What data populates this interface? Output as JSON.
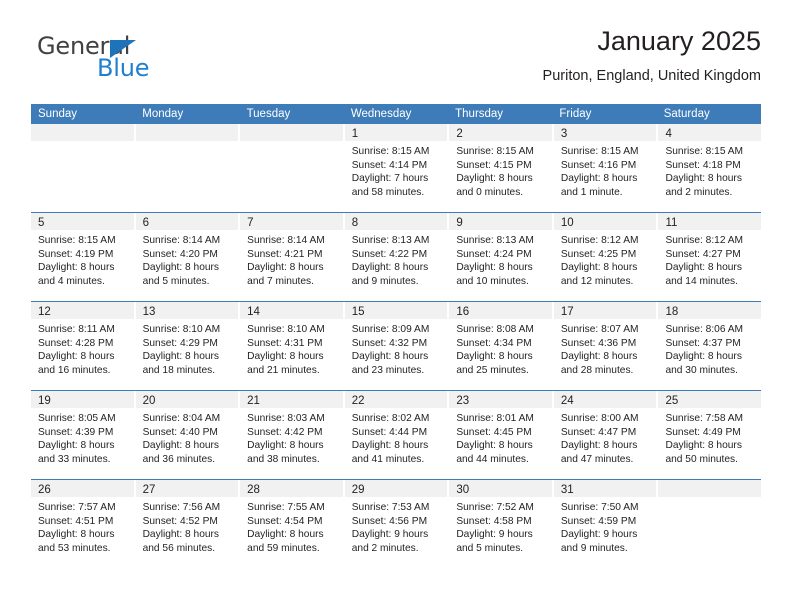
{
  "logo": {
    "word1": "General",
    "word2": "Blue",
    "triangle_color": "#1f73b8",
    "blue_color": "#1f7fd0"
  },
  "header": {
    "title": "January 2025",
    "subtitle": "Puriton, England, United Kingdom"
  },
  "calendar": {
    "header_bg": "#3d7cb8",
    "day_band_bg": "#f1f1f1",
    "weekdays": [
      "Sunday",
      "Monday",
      "Tuesday",
      "Wednesday",
      "Thursday",
      "Friday",
      "Saturday"
    ],
    "weeks": [
      [
        {
          "day": "",
          "lines": []
        },
        {
          "day": "",
          "lines": []
        },
        {
          "day": "",
          "lines": []
        },
        {
          "day": "1",
          "lines": [
            "Sunrise: 8:15 AM",
            "Sunset: 4:14 PM",
            "Daylight: 7 hours",
            "and 58 minutes."
          ]
        },
        {
          "day": "2",
          "lines": [
            "Sunrise: 8:15 AM",
            "Sunset: 4:15 PM",
            "Daylight: 8 hours",
            "and 0 minutes."
          ]
        },
        {
          "day": "3",
          "lines": [
            "Sunrise: 8:15 AM",
            "Sunset: 4:16 PM",
            "Daylight: 8 hours",
            "and 1 minute."
          ]
        },
        {
          "day": "4",
          "lines": [
            "Sunrise: 8:15 AM",
            "Sunset: 4:18 PM",
            "Daylight: 8 hours",
            "and 2 minutes."
          ]
        }
      ],
      [
        {
          "day": "5",
          "lines": [
            "Sunrise: 8:15 AM",
            "Sunset: 4:19 PM",
            "Daylight: 8 hours",
            "and 4 minutes."
          ]
        },
        {
          "day": "6",
          "lines": [
            "Sunrise: 8:14 AM",
            "Sunset: 4:20 PM",
            "Daylight: 8 hours",
            "and 5 minutes."
          ]
        },
        {
          "day": "7",
          "lines": [
            "Sunrise: 8:14 AM",
            "Sunset: 4:21 PM",
            "Daylight: 8 hours",
            "and 7 minutes."
          ]
        },
        {
          "day": "8",
          "lines": [
            "Sunrise: 8:13 AM",
            "Sunset: 4:22 PM",
            "Daylight: 8 hours",
            "and 9 minutes."
          ]
        },
        {
          "day": "9",
          "lines": [
            "Sunrise: 8:13 AM",
            "Sunset: 4:24 PM",
            "Daylight: 8 hours",
            "and 10 minutes."
          ]
        },
        {
          "day": "10",
          "lines": [
            "Sunrise: 8:12 AM",
            "Sunset: 4:25 PM",
            "Daylight: 8 hours",
            "and 12 minutes."
          ]
        },
        {
          "day": "11",
          "lines": [
            "Sunrise: 8:12 AM",
            "Sunset: 4:27 PM",
            "Daylight: 8 hours",
            "and 14 minutes."
          ]
        }
      ],
      [
        {
          "day": "12",
          "lines": [
            "Sunrise: 8:11 AM",
            "Sunset: 4:28 PM",
            "Daylight: 8 hours",
            "and 16 minutes."
          ]
        },
        {
          "day": "13",
          "lines": [
            "Sunrise: 8:10 AM",
            "Sunset: 4:29 PM",
            "Daylight: 8 hours",
            "and 18 minutes."
          ]
        },
        {
          "day": "14",
          "lines": [
            "Sunrise: 8:10 AM",
            "Sunset: 4:31 PM",
            "Daylight: 8 hours",
            "and 21 minutes."
          ]
        },
        {
          "day": "15",
          "lines": [
            "Sunrise: 8:09 AM",
            "Sunset: 4:32 PM",
            "Daylight: 8 hours",
            "and 23 minutes."
          ]
        },
        {
          "day": "16",
          "lines": [
            "Sunrise: 8:08 AM",
            "Sunset: 4:34 PM",
            "Daylight: 8 hours",
            "and 25 minutes."
          ]
        },
        {
          "day": "17",
          "lines": [
            "Sunrise: 8:07 AM",
            "Sunset: 4:36 PM",
            "Daylight: 8 hours",
            "and 28 minutes."
          ]
        },
        {
          "day": "18",
          "lines": [
            "Sunrise: 8:06 AM",
            "Sunset: 4:37 PM",
            "Daylight: 8 hours",
            "and 30 minutes."
          ]
        }
      ],
      [
        {
          "day": "19",
          "lines": [
            "Sunrise: 8:05 AM",
            "Sunset: 4:39 PM",
            "Daylight: 8 hours",
            "and 33 minutes."
          ]
        },
        {
          "day": "20",
          "lines": [
            "Sunrise: 8:04 AM",
            "Sunset: 4:40 PM",
            "Daylight: 8 hours",
            "and 36 minutes."
          ]
        },
        {
          "day": "21",
          "lines": [
            "Sunrise: 8:03 AM",
            "Sunset: 4:42 PM",
            "Daylight: 8 hours",
            "and 38 minutes."
          ]
        },
        {
          "day": "22",
          "lines": [
            "Sunrise: 8:02 AM",
            "Sunset: 4:44 PM",
            "Daylight: 8 hours",
            "and 41 minutes."
          ]
        },
        {
          "day": "23",
          "lines": [
            "Sunrise: 8:01 AM",
            "Sunset: 4:45 PM",
            "Daylight: 8 hours",
            "and 44 minutes."
          ]
        },
        {
          "day": "24",
          "lines": [
            "Sunrise: 8:00 AM",
            "Sunset: 4:47 PM",
            "Daylight: 8 hours",
            "and 47 minutes."
          ]
        },
        {
          "day": "25",
          "lines": [
            "Sunrise: 7:58 AM",
            "Sunset: 4:49 PM",
            "Daylight: 8 hours",
            "and 50 minutes."
          ]
        }
      ],
      [
        {
          "day": "26",
          "lines": [
            "Sunrise: 7:57 AM",
            "Sunset: 4:51 PM",
            "Daylight: 8 hours",
            "and 53 minutes."
          ]
        },
        {
          "day": "27",
          "lines": [
            "Sunrise: 7:56 AM",
            "Sunset: 4:52 PM",
            "Daylight: 8 hours",
            "and 56 minutes."
          ]
        },
        {
          "day": "28",
          "lines": [
            "Sunrise: 7:55 AM",
            "Sunset: 4:54 PM",
            "Daylight: 8 hours",
            "and 59 minutes."
          ]
        },
        {
          "day": "29",
          "lines": [
            "Sunrise: 7:53 AM",
            "Sunset: 4:56 PM",
            "Daylight: 9 hours",
            "and 2 minutes."
          ]
        },
        {
          "day": "30",
          "lines": [
            "Sunrise: 7:52 AM",
            "Sunset: 4:58 PM",
            "Daylight: 9 hours",
            "and 5 minutes."
          ]
        },
        {
          "day": "31",
          "lines": [
            "Sunrise: 7:50 AM",
            "Sunset: 4:59 PM",
            "Daylight: 9 hours",
            "and 9 minutes."
          ]
        },
        {
          "day": "",
          "lines": []
        }
      ]
    ]
  }
}
